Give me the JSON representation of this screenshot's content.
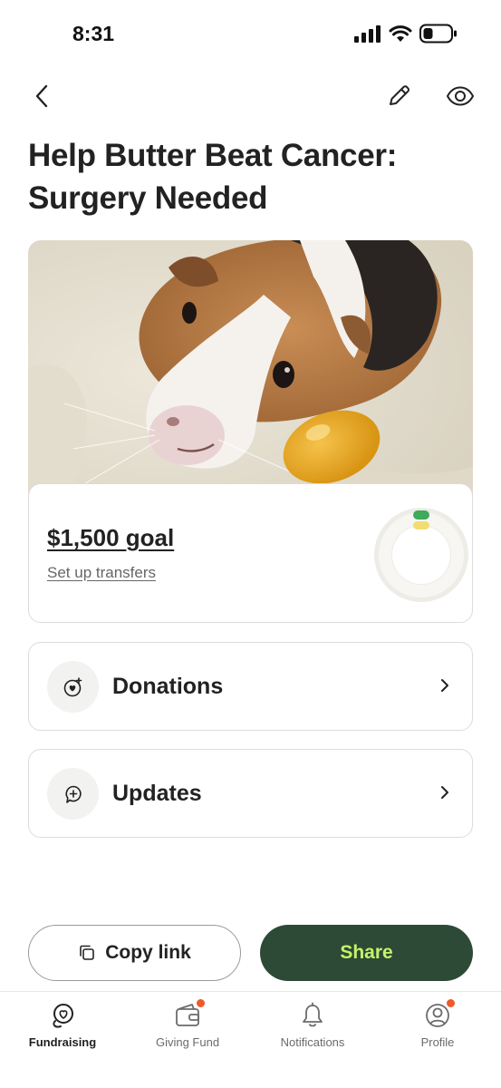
{
  "status_bar": {
    "time": "8:31"
  },
  "campaign": {
    "title": "Help Butter Beat Cancer: Surgery Needed",
    "goal_text": "$1,500 goal",
    "setup_transfers": "Set up transfers"
  },
  "sections": [
    {
      "label": "Donations",
      "icon": "donations-heart-icon"
    },
    {
      "label": "Updates",
      "icon": "updates-plus-icon"
    }
  ],
  "actions": {
    "copy_link": "Copy link",
    "share": "Share"
  },
  "tabs": [
    {
      "label": "Fundraising",
      "icon": "fundraising-heart-icon",
      "active": true,
      "badge": false
    },
    {
      "label": "Giving Fund",
      "icon": "wallet-icon",
      "active": false,
      "badge": true
    },
    {
      "label": "Notifications",
      "icon": "bell-icon",
      "active": false,
      "badge": false
    },
    {
      "label": "Profile",
      "icon": "profile-icon",
      "active": false,
      "badge": true
    }
  ],
  "colors": {
    "share_bg": "#2c4a35",
    "share_text": "#c7f26b",
    "badge": "#ef5a2a",
    "progress_green": "#3eaa5a",
    "progress_yellow": "#f1dd73"
  }
}
